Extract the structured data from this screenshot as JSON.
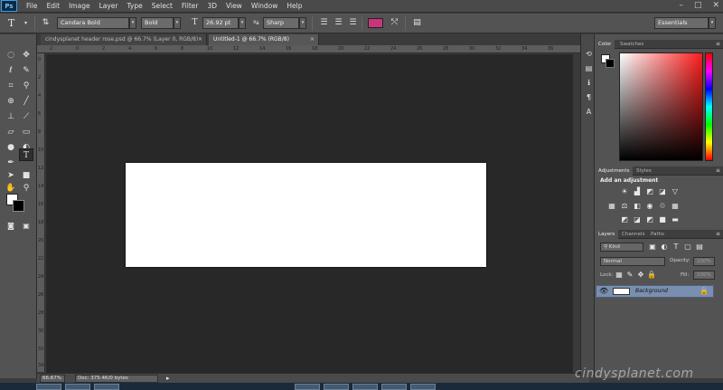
{
  "app": {
    "logo": "Ps"
  },
  "menu": [
    "File",
    "Edit",
    "Image",
    "Layer",
    "Type",
    "Select",
    "Filter",
    "3D",
    "View",
    "Window",
    "Help"
  ],
  "window_controls": {
    "minimize": "–",
    "maximize": "□",
    "close": "✕"
  },
  "options_bar": {
    "tool_glyph": "T",
    "font_family": "Candara Bold",
    "font_style": "Bold",
    "font_size": "26.92 pt",
    "antialias": "Sharp",
    "text_color": "#c8357a",
    "workspace": "Essentials"
  },
  "tabs": [
    {
      "label": "cindysplanet header rose.psd @ 66.7% (Layer 0, RGB/8)",
      "close": "×",
      "active": false
    },
    {
      "label": "Untitled-1 @ 66.7% (RGB/8)",
      "close": "×",
      "active": true
    }
  ],
  "ruler_ticks": [
    "2",
    "0",
    "2",
    "4",
    "6",
    "8",
    "10",
    "12",
    "14",
    "16",
    "18",
    "20",
    "22",
    "24",
    "26",
    "28",
    "30",
    "32",
    "34",
    "36"
  ],
  "ruler_left_ticks": [
    "0",
    "2",
    "4",
    "6",
    "8",
    "10",
    "12",
    "14",
    "16",
    "18",
    "20",
    "22",
    "24",
    "26",
    "28",
    "30",
    "32",
    "34"
  ],
  "status": {
    "zoom": "66.67%",
    "doc": "Doc: 375.4K/0 bytes"
  },
  "panels": {
    "color": {
      "tabs": [
        "Color",
        "Swatches"
      ]
    },
    "adjustments": {
      "tabs": [
        "Adjustments",
        "Styles"
      ],
      "title": "Add an adjustment"
    },
    "layers": {
      "tabs": [
        "Layers",
        "Channels",
        "Paths"
      ],
      "kind": "Kind",
      "blend_mode": "Normal",
      "opacity_label": "Opacity:",
      "opacity_value": "100%",
      "lock_label": "Lock:",
      "fill_label": "Fill:",
      "fill_value": "100%",
      "layer_name": "Background"
    }
  },
  "watermark": "cindysplanet.com"
}
